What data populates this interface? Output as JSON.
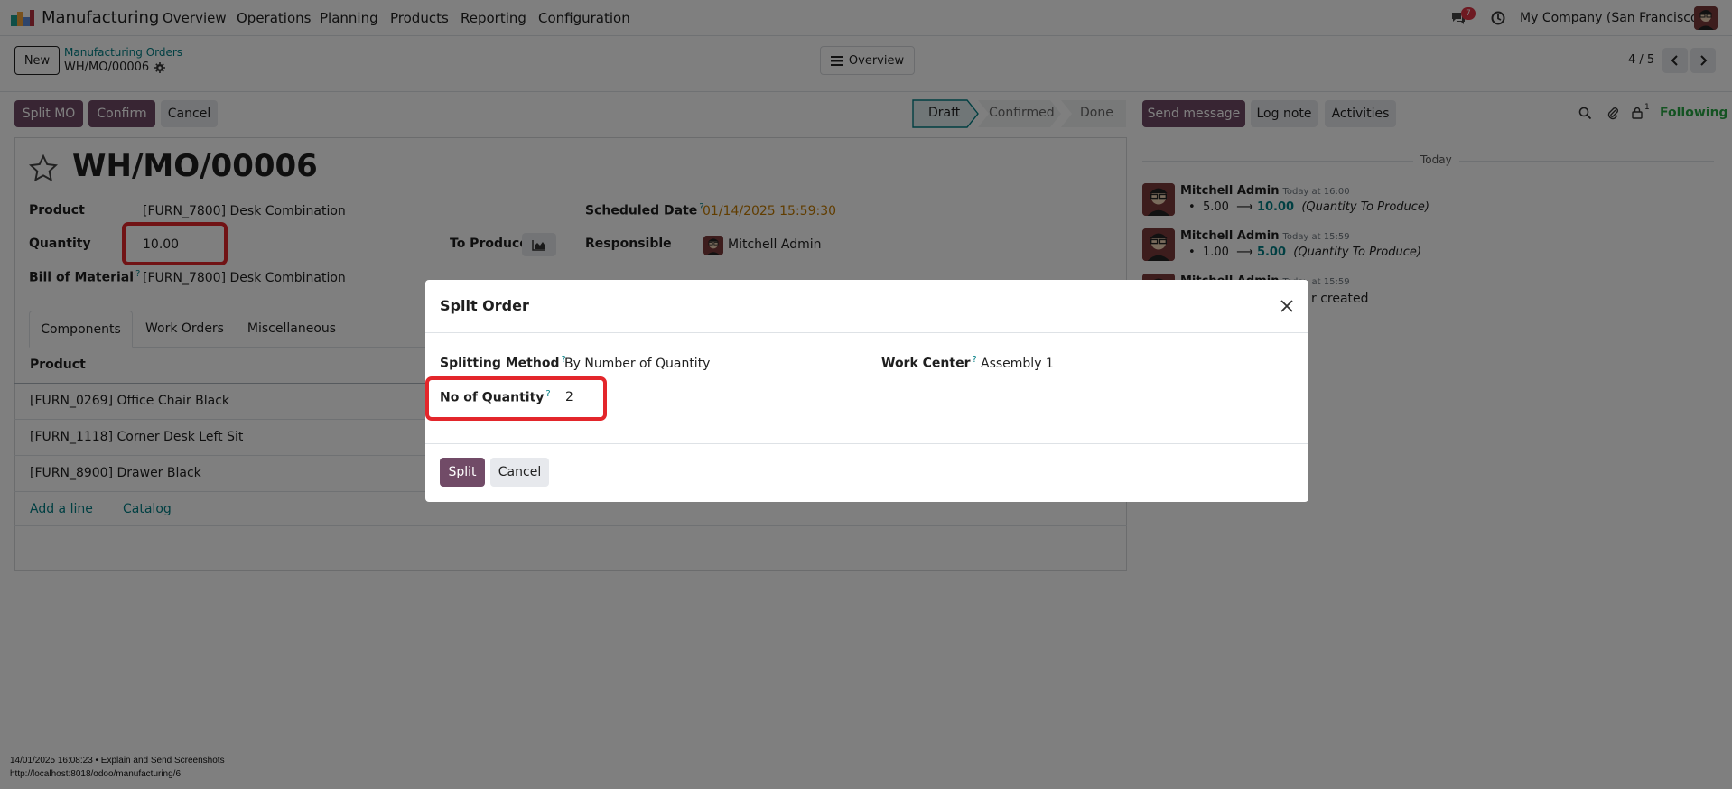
{
  "navbar": {
    "app_name": "Manufacturing",
    "menu": [
      "Overview",
      "Operations",
      "Planning",
      "Products",
      "Reporting",
      "Configuration"
    ],
    "message_count": "7",
    "company": "My Company (San Francisco)"
  },
  "control_panel": {
    "new_label": "New",
    "breadcrumb_parent": "Manufacturing Orders",
    "breadcrumb_current": "WH/MO/00006",
    "overview_label": "Overview",
    "pager": "4 / 5"
  },
  "statusbar": {
    "buttons": [
      "Split MO",
      "Confirm",
      "Cancel"
    ],
    "stages": [
      "Draft",
      "Confirmed",
      "Done"
    ],
    "active_stage": "Draft"
  },
  "form": {
    "title": "WH/MO/00006",
    "product_label": "Product",
    "product_value": "[FURN_7800] Desk Combination",
    "quantity_label": "Quantity",
    "quantity_value": "10.00",
    "to_produce_label": "To Produce",
    "bom_label": "Bill of Material",
    "bom_value": "[FURN_7800] Desk Combination",
    "scheduled_label": "Scheduled Date",
    "scheduled_value": "01/14/2025 15:59:30",
    "responsible_label": "Responsible",
    "responsible_value": "Mitchell Admin",
    "tabs": [
      "Components",
      "Work Orders",
      "Miscellaneous"
    ],
    "column_product": "Product",
    "components": [
      "[FURN_0269] Office Chair Black",
      "[FURN_1118] Corner Desk Left Sit",
      "[FURN_8900] Drawer Black"
    ],
    "add_line": "Add a line",
    "catalog": "Catalog"
  },
  "chatter": {
    "send_message": "Send message",
    "log_note": "Log note",
    "activities": "Activities",
    "followers_count": "1",
    "following": "Following",
    "date_separator": "Today",
    "messages": [
      {
        "author": "Mitchell Admin",
        "time": "Today at 16:00",
        "old": "5.00",
        "arrow": "⟶",
        "new": "10.00",
        "field": "(Quantity To Produce)"
      },
      {
        "author": "Mitchell Admin",
        "time": "Today at 15:59",
        "old": "1.00",
        "arrow": "⟶",
        "new": "5.00",
        "field": "(Quantity To Produce)"
      },
      {
        "author": "Mitchell Admin",
        "time": "Today at 15:59",
        "body": "r created"
      }
    ]
  },
  "dialog": {
    "title": "Split Order",
    "splitting_method_label": "Splitting Method",
    "splitting_method_value": "By Number of Quantity",
    "no_of_quantity_label": "No of Quantity",
    "no_of_quantity_value": "2",
    "work_center_label": "Work Center",
    "work_center_value": "Assembly 1",
    "split_label": "Split",
    "cancel_label": "Cancel"
  },
  "footer": {
    "line1": "14/01/2025 16:08:23 • Explain and Send Screenshots",
    "line2": "http://localhost:8018/odoo/manufacturing/6"
  },
  "colors": {
    "brand": "#714b67",
    "link": "#017e84",
    "highlight": "#e3262b",
    "date_warning": "#c27a00",
    "following": "#28a745"
  },
  "help_mark": "?"
}
